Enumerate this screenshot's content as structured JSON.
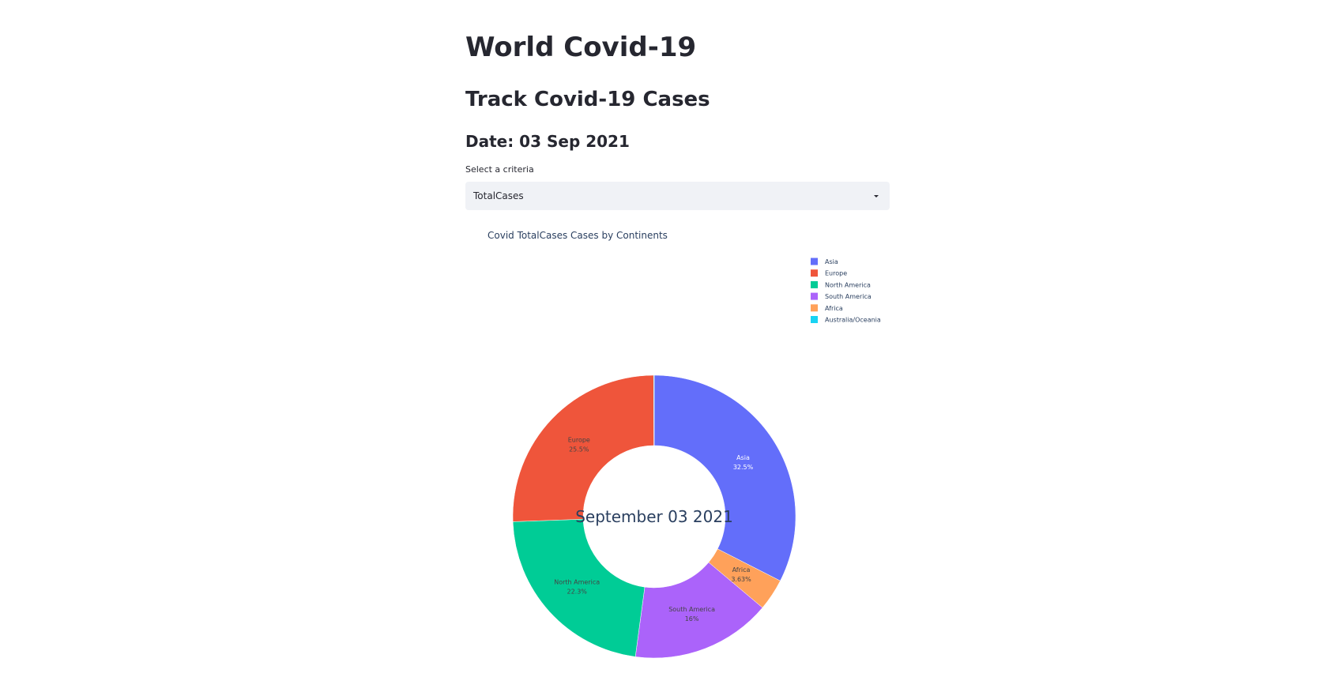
{
  "header": {
    "title": "World Covid-19",
    "subheader": "Track Covid-19 Cases",
    "date_heading": "Date: 03 Sep 2021"
  },
  "criteria_select": {
    "label": "Select a criteria",
    "selected_value": "TotalCases",
    "arrow_icon": "caret-down-icon"
  },
  "chart_data": {
    "type": "pie",
    "hole": true,
    "title": "Covid TotalCases Cases by Continents",
    "center_text": "September 03 2021",
    "legend_position": "top-right",
    "slices": [
      {
        "label": "Asia",
        "percent_label": "32.5%",
        "value": 32.5,
        "color": "#636efa",
        "text_color": "#ffffff"
      },
      {
        "label": "Africa",
        "percent_label": "3.63%",
        "value": 3.63,
        "color": "#ffa15a",
        "text_color": "#444444"
      },
      {
        "label": "South America",
        "percent_label": "16%",
        "value": 16,
        "color": "#ab63fa",
        "text_color": "#444444"
      },
      {
        "label": "North America",
        "percent_label": "22.3%",
        "value": 22.3,
        "color": "#00cc96",
        "text_color": "#444444"
      },
      {
        "label": "Europe",
        "percent_label": "25.5%",
        "value": 25.5,
        "color": "#ef553b",
        "text_color": "#444444"
      },
      {
        "label": "Australia/Oceania",
        "percent_label": "",
        "value": 0.07,
        "color": "#19d3f3",
        "text_color": "#444444"
      }
    ],
    "legend": [
      {
        "label": "Asia",
        "color": "#636efa"
      },
      {
        "label": "Europe",
        "color": "#ef553b"
      },
      {
        "label": "North America",
        "color": "#00cc96"
      },
      {
        "label": "South America",
        "color": "#ab63fa"
      },
      {
        "label": "Africa",
        "color": "#ffa15a"
      },
      {
        "label": "Australia/Oceania",
        "color": "#19d3f3"
      }
    ]
  }
}
